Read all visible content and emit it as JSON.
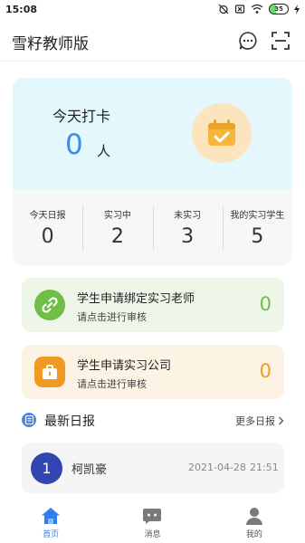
{
  "status_bar": {
    "time": "15:08",
    "battery": "35",
    "icons": [
      "alarm-off-icon",
      "sim-off-icon",
      "wifi-icon",
      "battery-icon",
      "charging-icon"
    ]
  },
  "header": {
    "title": "雪籽教师版",
    "icons": [
      "message-icon",
      "scan-icon"
    ]
  },
  "summary": {
    "checkin_label": "今天打卡",
    "checkin_count": "0",
    "checkin_unit": "人",
    "icon": "calendar-check-icon",
    "stats": [
      {
        "label": "今天日报",
        "value": "0"
      },
      {
        "label": "实习中",
        "value": "2"
      },
      {
        "label": "未实习",
        "value": "3"
      },
      {
        "label": "我的实习学生",
        "value": "5"
      }
    ]
  },
  "requests": [
    {
      "title": "学生申请绑定实习老师",
      "subtitle": "请点击进行审核",
      "count": "0",
      "icon": "link-icon",
      "color": "#6fbe48"
    },
    {
      "title": "学生申请实习公司",
      "subtitle": "请点击进行审核",
      "count": "0",
      "icon": "briefcase-icon",
      "color": "#f19a23"
    }
  ],
  "reports": {
    "title": "最新日报",
    "more": "更多日报",
    "items": [
      {
        "avatar": "1",
        "name": "柯凯豪",
        "date": "2021-04-28",
        "time": "21:51"
      }
    ]
  },
  "nav": [
    {
      "label": "首页",
      "icon": "home-icon",
      "active": true
    },
    {
      "label": "消息",
      "icon": "chat-icon",
      "active": false
    },
    {
      "label": "我的",
      "icon": "user-icon",
      "active": false
    }
  ],
  "colors": {
    "accent": "#2f7ff0",
    "checkin_count": "#3b8de8",
    "summary_bg": "#e3f7fd",
    "calendar_bg": "#fce4bf",
    "avatar": "#3346b0"
  }
}
